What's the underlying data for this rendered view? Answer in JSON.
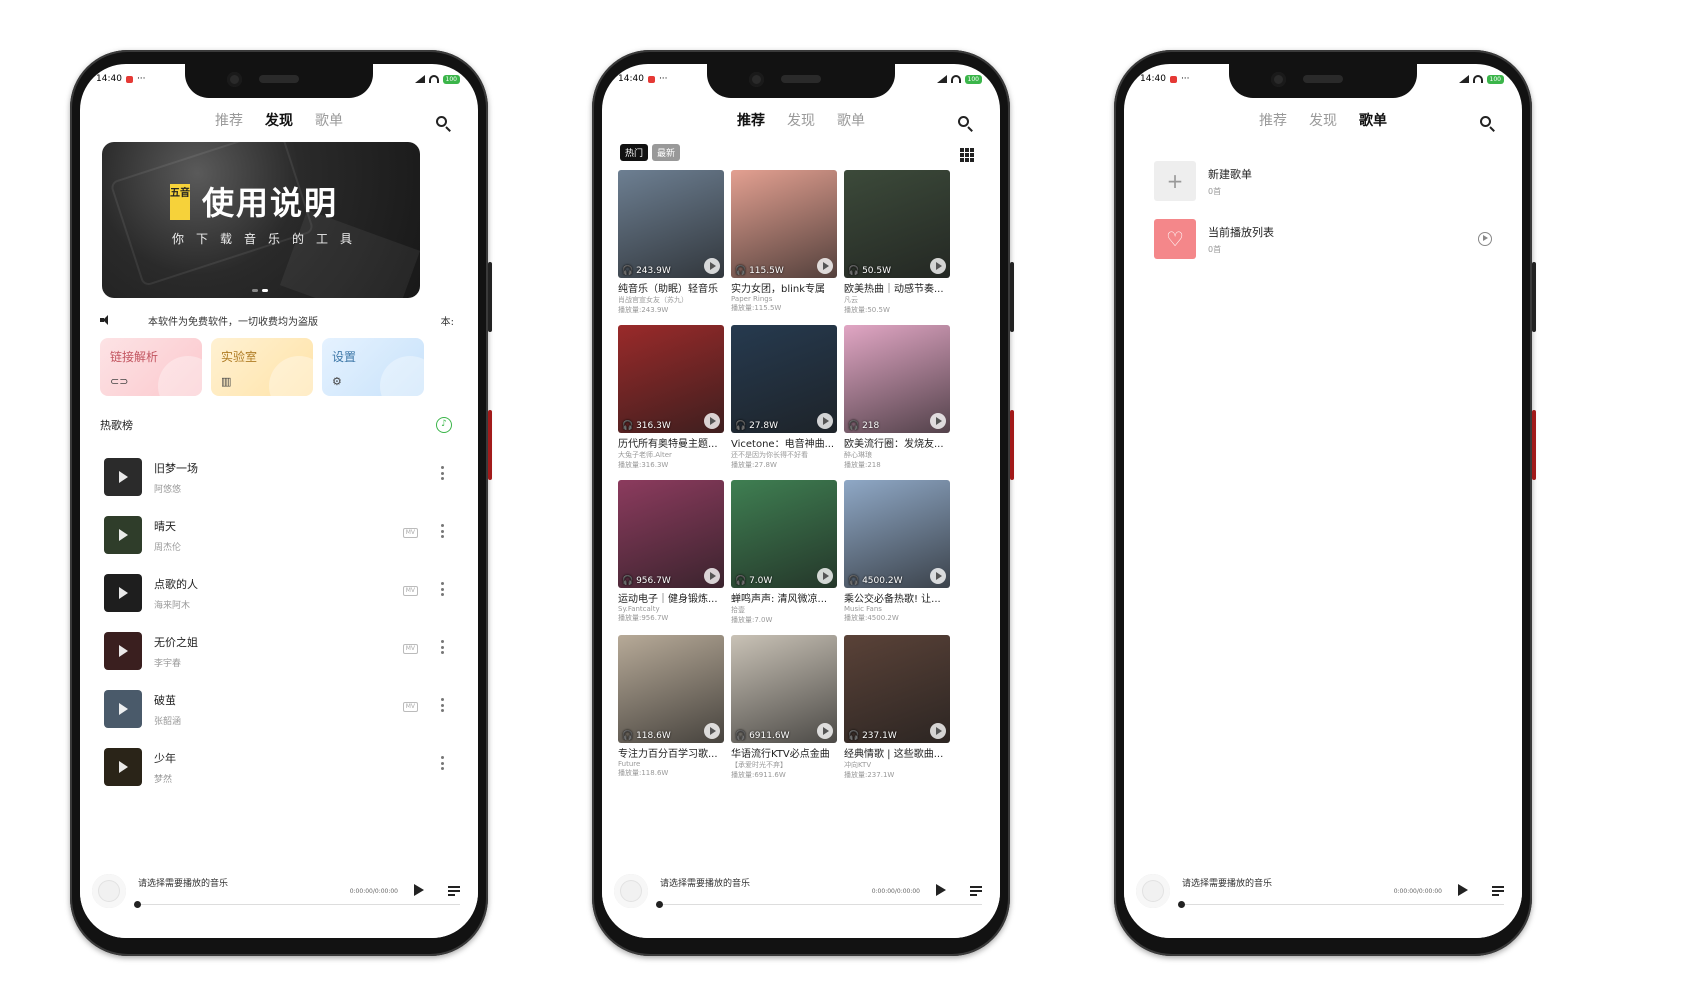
{
  "status_bar": {
    "time": "14:40",
    "battery": "100"
  },
  "tabs": [
    "推荐",
    "发现",
    "歌单"
  ],
  "phone1": {
    "banner": {
      "badge": "五音",
      "title": "使用说明",
      "subtitle": "你下载音乐的工具"
    },
    "notice": {
      "text": "本软件为免费软件，一切收费均为盗版",
      "tail": "本:"
    },
    "quick_cards": [
      "链接解析",
      "实验室",
      "设置"
    ],
    "hot_title": "热歌榜",
    "songs": [
      {
        "name": "旧梦一场",
        "artist": "阿悠悠",
        "mv": "",
        "color": "#2b2b2b"
      },
      {
        "name": "晴天",
        "artist": "周杰伦",
        "mv": "MV",
        "color": "#2f3d2a"
      },
      {
        "name": "点歌的人",
        "artist": "海来阿木",
        "mv": "MV",
        "color": "#1e1e1e"
      },
      {
        "name": "无价之姐",
        "artist": "李宇春",
        "mv": "MV",
        "color": "#3a1f1f"
      },
      {
        "name": "破茧",
        "artist": "张韶涵",
        "mv": "MV",
        "color": "#4a5a6a"
      },
      {
        "name": "少年",
        "artist": "梦然",
        "mv": "",
        "color": "#2a2418"
      }
    ]
  },
  "phone2": {
    "filters": [
      "热门",
      "最新"
    ],
    "playlists": [
      {
        "title": "纯音乐（助眠）轻音乐",
        "author": "肖战官宣女友（苏九）",
        "plays": "243.9W",
        "count": "播放量:243.9W",
        "color": "#6d7f92"
      },
      {
        "title": "实力女团，blink专属",
        "author": "Paper Rings",
        "plays": "115.5W",
        "count": "播放量:115.5W",
        "color": "#e3a091"
      },
      {
        "title": "欧美热曲｜动感节奏...",
        "author": "凡云",
        "plays": "50.5W",
        "count": "播放量:50.5W",
        "color": "#3c4a3a"
      },
      {
        "title": "历代所有奥特曼主题...",
        "author": "大兔子老师.Alter",
        "plays": "316.3W",
        "count": "播放量:316.3W",
        "color": "#9a2a2a"
      },
      {
        "title": "Vicetone：电音神曲...",
        "author": "还不是因为你长得不好看",
        "plays": "27.8W",
        "count": "播放量:27.8W",
        "color": "#263a4f"
      },
      {
        "title": "欧美流行圈：发烧友...",
        "author": "醉心琳琅",
        "plays": "218",
        "count": "播放量:218",
        "color": "#e1a6c4"
      },
      {
        "title": "运动电子｜健身锻炼...",
        "author": "Sy.Fantcalty",
        "plays": "956.7W",
        "count": "播放量:956.7W",
        "color": "#8c3b5e"
      },
      {
        "title": "蝉鸣声声: 清风微凉...",
        "author": "拾壹",
        "plays": "7.0W",
        "count": "播放量:7.0W",
        "color": "#3f7f52"
      },
      {
        "title": "乘公交必备热歌! 让...",
        "author": "Music Fans",
        "plays": "4500.2W",
        "count": "播放量:4500.2W",
        "color": "#8fa8c6"
      },
      {
        "title": "专注力百分百学习歌...",
        "author": "Future",
        "plays": "118.6W",
        "count": "播放量:118.6W",
        "color": "#b7aa98"
      },
      {
        "title": "华语流行KTV必点金曲",
        "author": "【承爱时光不弃】",
        "plays": "6911.6W",
        "count": "播放量:6911.6W",
        "color": "#c9c2b6"
      },
      {
        "title": "经典情歌 | 这些歌曲...",
        "author": "冲向KTV",
        "plays": "237.1W",
        "count": "播放量:237.1W",
        "color": "#5a4238"
      }
    ]
  },
  "phone3": {
    "lists": [
      {
        "name": "新建歌单",
        "count": "0首",
        "icon": "plus-icon"
      },
      {
        "name": "当前播放列表",
        "count": "0首",
        "icon": "heart-icon"
      }
    ]
  },
  "player": {
    "title": "请选择需要播放的音乐",
    "time": "0:00:00/0:00:00"
  },
  "colors": {
    "accent_green": "#3bb54a",
    "heart_pink": "#f4878a"
  }
}
